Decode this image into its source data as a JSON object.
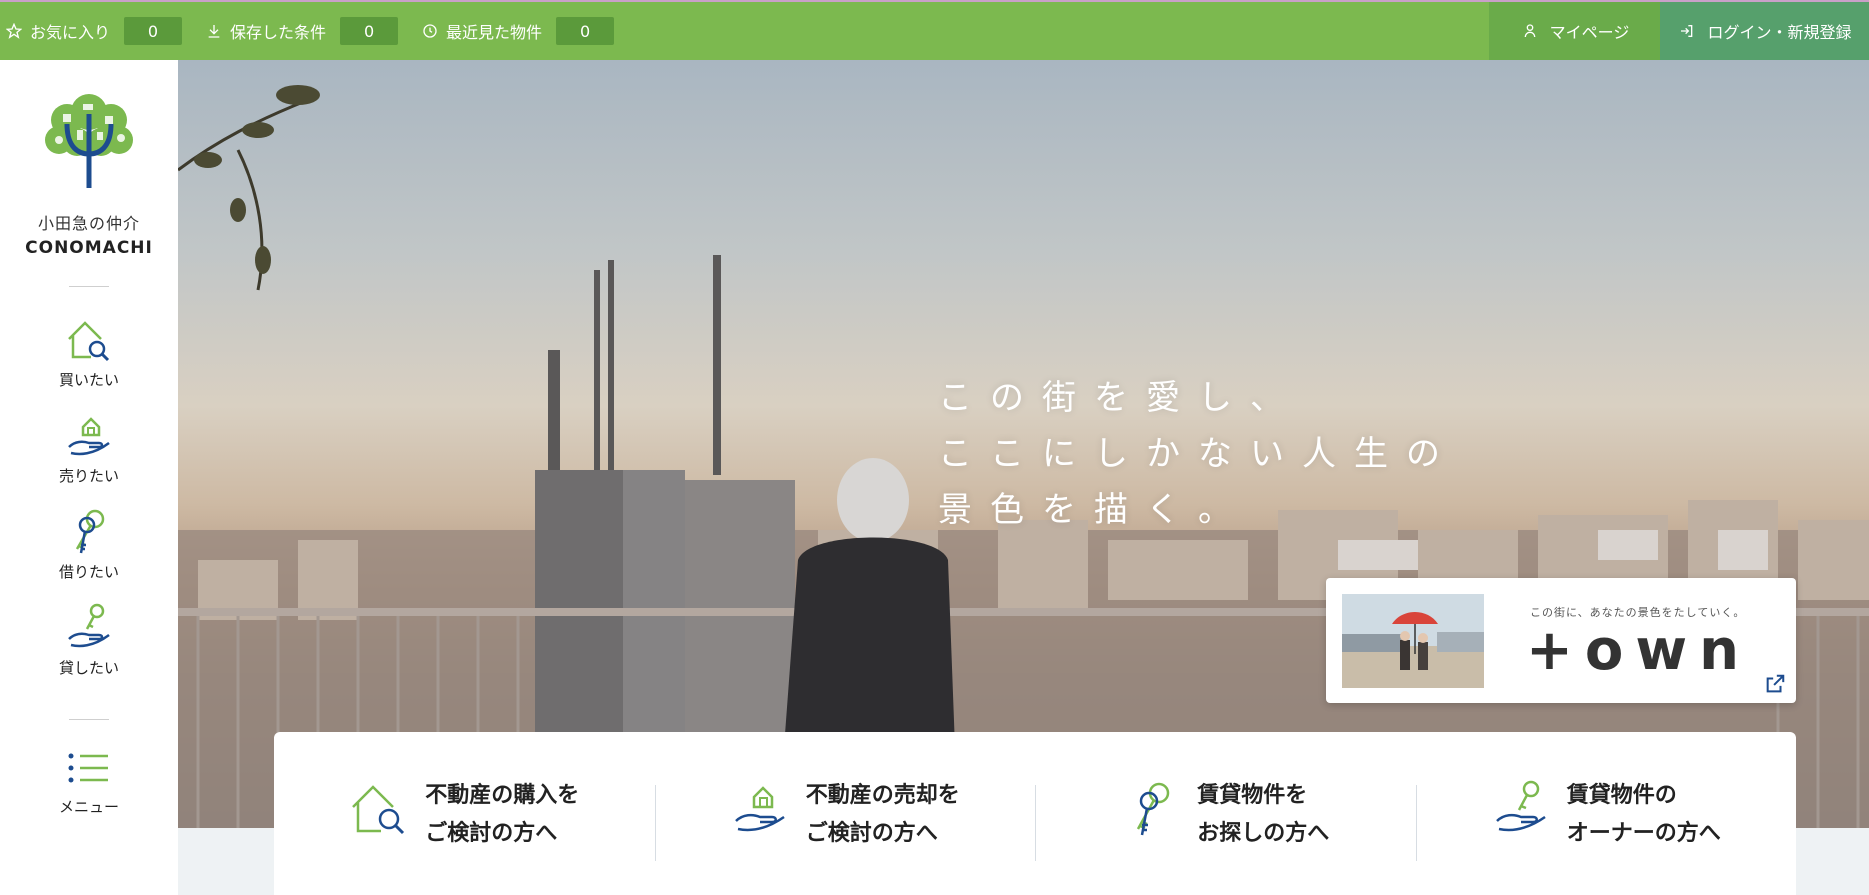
{
  "topbar": {
    "favorites": {
      "label": "お気に入り",
      "count": "0",
      "icon": "star-icon"
    },
    "saved": {
      "label": "保存した条件",
      "count": "0",
      "icon": "download-icon"
    },
    "recent": {
      "label": "最近見た物件",
      "count": "0",
      "icon": "clock-icon"
    },
    "mypage": {
      "label": "マイページ",
      "icon": "person-icon"
    },
    "login": {
      "label": "ログイン・新規登録",
      "icon": "login-icon"
    }
  },
  "sidebar": {
    "brand_jp": "小田急の仲介",
    "brand_en": "CONOMACHI",
    "items": [
      {
        "label": "買いたい",
        "icon": "house-search-icon"
      },
      {
        "label": "売りたい",
        "icon": "hand-house-icon"
      },
      {
        "label": "借りたい",
        "icon": "keys-icon"
      },
      {
        "label": "貸したい",
        "icon": "hand-key-icon"
      }
    ],
    "menu": {
      "label": "メニュー",
      "icon": "menu-list-icon"
    }
  },
  "hero": {
    "catch_lines": [
      "この街を愛し、",
      "ここにしかない人生の",
      "景色を描く。"
    ]
  },
  "banner": {
    "tagline": "この街に、あなたの景色をたしていく。",
    "logo_text": "+own",
    "icon": "external-link-icon"
  },
  "quick": [
    {
      "line1": "不動産の購入を",
      "line2": "ご検討の方へ",
      "icon": "house-search-icon"
    },
    {
      "line1": "不動産の売却を",
      "line2": "ご検討の方へ",
      "icon": "hand-house-icon"
    },
    {
      "line1": "賃貸物件を",
      "line2": "お探しの方へ",
      "icon": "keys-icon"
    },
    {
      "line1": "賃貸物件の",
      "line2": "オーナーの方へ",
      "icon": "hand-key-icon"
    }
  ],
  "colors": {
    "green": "#7cb94f",
    "dark_green": "#5b9a3b",
    "teal": "#56a06c",
    "navy": "#1d4c8f"
  }
}
